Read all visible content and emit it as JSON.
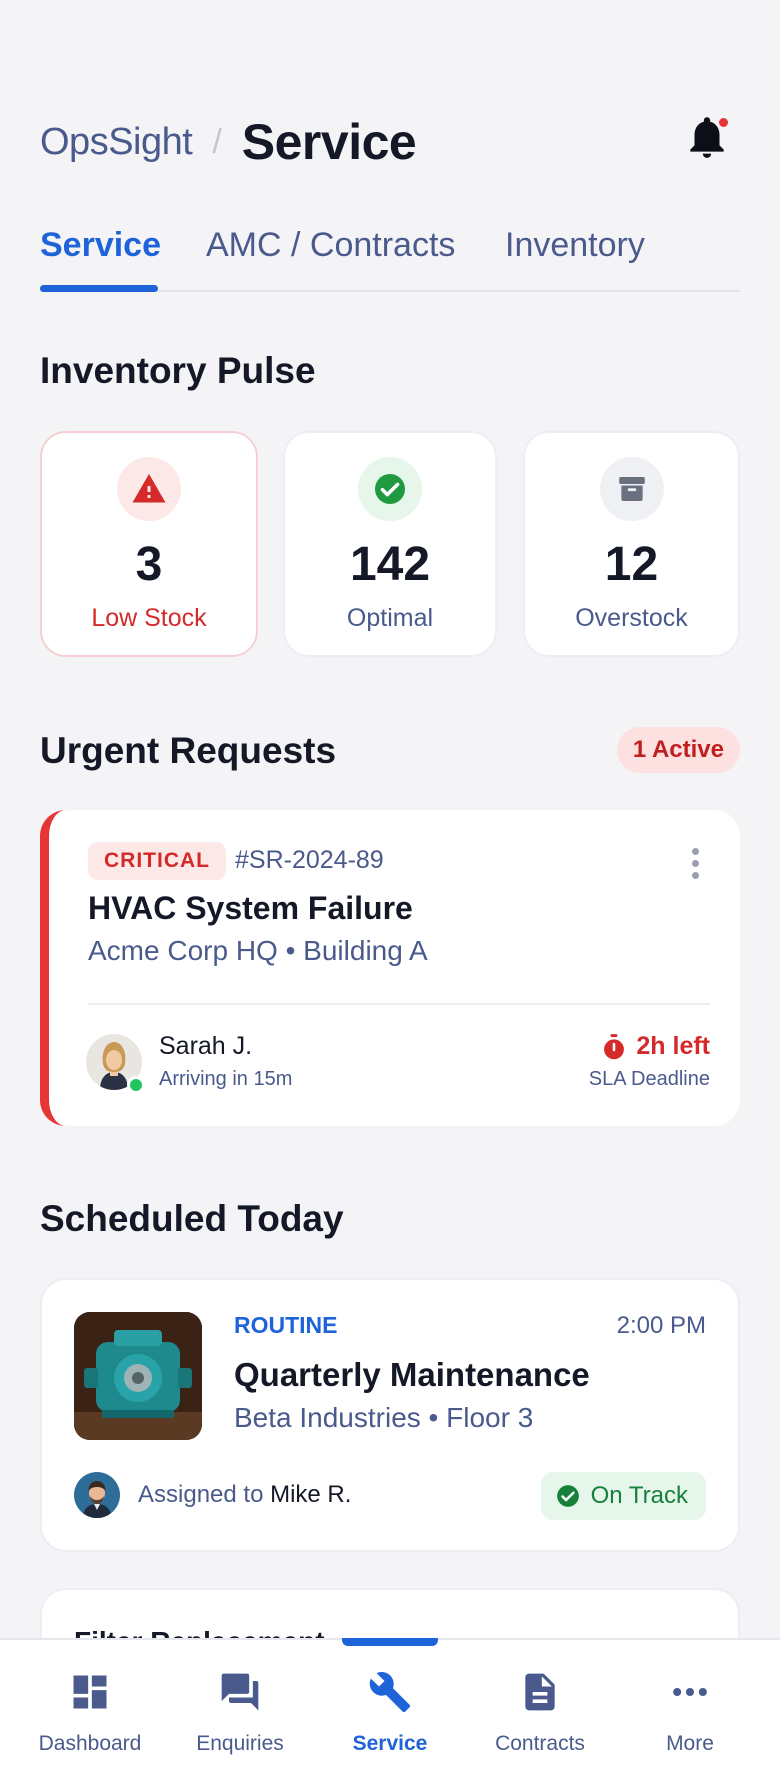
{
  "header": {
    "brand": "OpsSight",
    "separator": "/",
    "title": "Service"
  },
  "tabs": [
    {
      "label": "Service",
      "active": true
    },
    {
      "label": "AMC / Contracts",
      "active": false
    },
    {
      "label": "Inventory",
      "active": false
    }
  ],
  "inventory": {
    "title": "Inventory Pulse",
    "cards": [
      {
        "icon": "warning-icon",
        "value": "3",
        "label": "Low Stock"
      },
      {
        "icon": "check-circle-icon",
        "value": "142",
        "label": "Optimal"
      },
      {
        "icon": "archive-icon",
        "value": "12",
        "label": "Overstock"
      }
    ]
  },
  "urgent": {
    "title": "Urgent Requests",
    "badge": "1 Active",
    "request": {
      "priority": "CRITICAL",
      "id": "#SR-2024-89",
      "title": "HVAC System Failure",
      "location": "Acme Corp HQ  •  Building A",
      "technician": "Sarah J.",
      "eta": "Arriving in 15m",
      "sla_time": "2h left",
      "sla_label": "SLA Deadline"
    }
  },
  "scheduled": {
    "title": "Scheduled Today",
    "job": {
      "tag": "ROUTINE",
      "time": "2:00 PM",
      "title": "Quarterly Maintenance",
      "location": "Beta Industries  •  Floor 3",
      "assigned_prefix": "Assigned to ",
      "assignee": "Mike R.",
      "status": "On Track"
    },
    "next_title": "Filter Replacement"
  },
  "nav": [
    {
      "icon": "dashboard-icon",
      "label": "Dashboard"
    },
    {
      "icon": "chat-icon",
      "label": "Enquiries"
    },
    {
      "icon": "wrench-icon",
      "label": "Service",
      "active": true
    },
    {
      "icon": "document-icon",
      "label": "Contracts"
    },
    {
      "icon": "more-icon",
      "label": "More"
    }
  ],
  "colors": {
    "accent": "#1f63d8",
    "critical": "#e53535",
    "success": "#22a344",
    "muted": "#4a5a8c"
  }
}
